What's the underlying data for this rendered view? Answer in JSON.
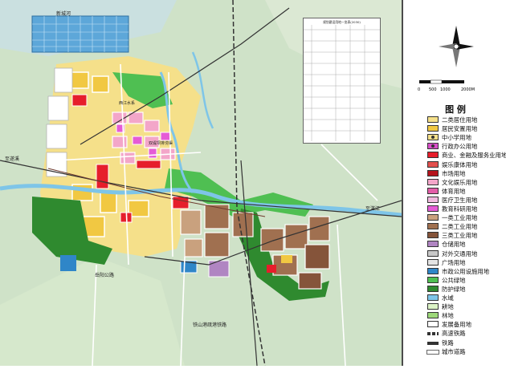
{
  "map": {
    "labels": {
      "north_river": "新城河",
      "west_text": "至遂溪",
      "east_text": "至湛江",
      "south_road": "岳阳公路",
      "south_rail": "铁山港疏港铁路",
      "canal_note": "双堤坝排涝渠",
      "mid_river": "西江水系"
    },
    "table_title": "规划建设用地一览表(2030)"
  },
  "scale": {
    "labels": [
      "0",
      "500",
      "1000",
      "2000M"
    ]
  },
  "legend": {
    "title": "图  例",
    "items": [
      {
        "label": "二类居住用地",
        "color": "#f5e08a",
        "icon": "square"
      },
      {
        "label": "居民安置用地",
        "color": "#f1c842",
        "icon": "square"
      },
      {
        "label": "中小学用地",
        "color": "#f5e08a",
        "icon": "school-icon"
      },
      {
        "label": "行政办公用地",
        "color": "#d94fc9",
        "icon": "office-icon"
      },
      {
        "label": "商业、金融及服务业用地",
        "color": "#e61e2b",
        "icon": "square"
      },
      {
        "label": "娱乐康体用地",
        "color": "#e3504e",
        "icon": "square"
      },
      {
        "label": "市场用地",
        "color": "#b5131c",
        "icon": "square"
      },
      {
        "label": "文化娱乐用地",
        "color": "#f3a6c9",
        "icon": "square"
      },
      {
        "label": "体育用地",
        "color": "#e35da8",
        "icon": "square"
      },
      {
        "label": "医疗卫生用地",
        "color": "#f0b9de",
        "icon": "square"
      },
      {
        "label": "教育科研用地",
        "color": "#e55bd6",
        "icon": "square"
      },
      {
        "label": "一类工业用地",
        "color": "#c9a17e",
        "icon": "square"
      },
      {
        "label": "二类工业用地",
        "color": "#a07050",
        "icon": "square"
      },
      {
        "label": "三类工业用地",
        "color": "#85543a",
        "icon": "square"
      },
      {
        "label": "仓储用地",
        "color": "#b085c2",
        "icon": "square"
      },
      {
        "label": "对外交通用地",
        "color": "#c9c9c9",
        "icon": "square"
      },
      {
        "label": "广场用地",
        "color": "#e4e4e4",
        "icon": "square"
      },
      {
        "label": "市政公用设施用地",
        "color": "#2f86c8",
        "icon": "square"
      },
      {
        "label": "公共绿地",
        "color": "#4fbf52",
        "icon": "square"
      },
      {
        "label": "防护绿地",
        "color": "#2f8a2f",
        "icon": "square"
      },
      {
        "label": "水域",
        "color": "#7ec5e8",
        "icon": "square"
      },
      {
        "label": "耕地",
        "color": "#dcf3c6",
        "icon": "square"
      },
      {
        "label": "林地",
        "color": "#9dd87a",
        "icon": "square"
      },
      {
        "label": "发展备用地",
        "color": "#ffffff",
        "icon": "square"
      },
      {
        "label": "高速铁路",
        "color": "#333333",
        "icon": "hsr-line"
      },
      {
        "label": "铁路",
        "color": "#333333",
        "icon": "rail-line"
      },
      {
        "label": "城市道路",
        "color": "#ffffff",
        "icon": "road-line"
      }
    ]
  }
}
